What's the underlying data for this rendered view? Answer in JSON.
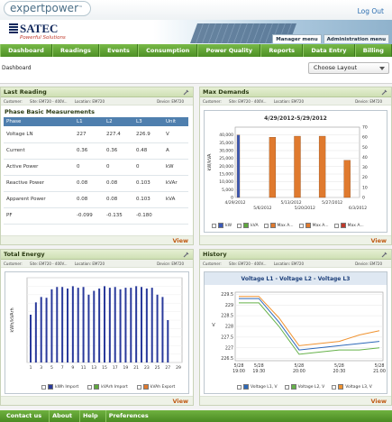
{
  "app": {
    "brand": "expertpower",
    "brand_tm": "™",
    "logout": "Log Out"
  },
  "company": {
    "name": "SATEC",
    "tagline": "Powerful Solutions"
  },
  "menus": {
    "manager": "Manager menu",
    "admin": "Administration menu"
  },
  "nav": [
    "Dashboard",
    "Readings",
    "Events",
    "Consumption",
    "Power Quality",
    "Reports",
    "Data Entry",
    "Billing"
  ],
  "page": {
    "title": "Dashboard",
    "layout_select": "Choose Layout"
  },
  "meta": {
    "customer": "Customer:",
    "site": "Site: EM720 - 400V...",
    "location": "Location: EM720",
    "device": "Device: EM720"
  },
  "view_label": "View",
  "last_reading": {
    "title": "Last Reading",
    "subtitle": "Phase Basic Measurements",
    "columns": [
      "Phase",
      "L1",
      "L2",
      "L3",
      "Unit"
    ],
    "rows": [
      [
        "Voltage LN",
        "227",
        "227.4",
        "226.9",
        "V"
      ],
      [
        "Current",
        "0.36",
        "0.36",
        "0.48",
        "A"
      ],
      [
        "Active Power",
        "0",
        "0",
        "0",
        "kW"
      ],
      [
        "Reactive Power",
        "0.08",
        "0.08",
        "0.103",
        "kVAr"
      ],
      [
        "Apparent Power",
        "0.08",
        "0.08",
        "0.103",
        "kVA"
      ],
      [
        "PF",
        "-0.099",
        "-0.135",
        "-0.180",
        ""
      ]
    ]
  },
  "max_demands": {
    "title": "Max Demands",
    "legend": [
      "kW",
      "kVA",
      "Max A...",
      "Max A...",
      "Max A..."
    ]
  },
  "total_energy": {
    "title": "Total Energy",
    "legend": [
      "kWh Import",
      "kVArh Import",
      "kVAh Export"
    ]
  },
  "history": {
    "title": "History",
    "legend": [
      "Voltage L1, V",
      "Voltage L2, V",
      "Voltage L3, V"
    ]
  },
  "footer": [
    "Contact us",
    "About",
    "Help",
    "Preferences"
  ],
  "colors": {
    "nav_green": "#5a9e30",
    "header_blue": "#4f7fae",
    "view_orange": "#c05a14"
  },
  "chart_data": [
    {
      "type": "bar",
      "title": "4/29/2012-5/29/2012",
      "ylabel": "kW/kVA",
      "ylim": [
        0,
        45000
      ],
      "yticks": [
        0,
        5000,
        10000,
        15000,
        20000,
        25000,
        30000,
        35000,
        40000
      ],
      "y2lim": [
        0,
        70
      ],
      "y2ticks": [
        0,
        10,
        20,
        30,
        40,
        50,
        60,
        70
      ],
      "categories": [
        "4/29/2012\n5/6/2012",
        "5/6/2012",
        "5/13/2012",
        "5/20/2012",
        "5/27/2012\n6/3/2012"
      ],
      "xticklabels": [
        "4/29/2012",
        "5/6/2012",
        "5/13/2012",
        "5/20/2012",
        "5/27/2012",
        "6/3/2012"
      ],
      "series": [
        {
          "name": "kW",
          "axis": "y",
          "color": "#3b5ab8",
          "values": [
            40000,
            0,
            0,
            0,
            0
          ]
        },
        {
          "name": "Max A...",
          "axis": "y2",
          "color": "#e07a2e",
          "values": [
            0,
            60,
            61,
            61,
            37
          ]
        }
      ]
    },
    {
      "type": "bar",
      "ylabel": "kWh/kVArh",
      "ylim": [
        0,
        1.1
      ],
      "categories": [
        "1",
        "2",
        "3",
        "4",
        "5",
        "6",
        "7",
        "8",
        "9",
        "10",
        "11",
        "12",
        "13",
        "14",
        "15",
        "16",
        "17",
        "18",
        "19",
        "20",
        "21",
        "22",
        "23",
        "24",
        "25",
        "26",
        "27"
      ],
      "xticklabels": [
        "1",
        "3",
        "5",
        "7",
        "9",
        "11",
        "13",
        "15",
        "17",
        "19",
        "21",
        "23",
        "25",
        "27",
        "29"
      ],
      "series": [
        {
          "name": "kWh Import",
          "color": "#2a3a9b",
          "values": [
            0.62,
            0.78,
            0.85,
            0.84,
            0.95,
            0.98,
            0.98,
            0.96,
            0.99,
            0.97,
            0.98,
            0.88,
            0.93,
            0.96,
            0.99,
            0.97,
            0.98,
            0.95,
            0.97,
            0.97,
            0.99,
            0.98,
            0.96,
            0.97,
            0.88,
            0.85,
            0.55
          ]
        }
      ]
    },
    {
      "type": "line",
      "title": "Voltage L1 - Voltage L2 - Voltage L3",
      "ylabel": "V",
      "ylim": [
        226.4,
        229.6
      ],
      "yticks": [
        226.5,
        227,
        227.5,
        228,
        228.5,
        229,
        229.5
      ],
      "x": [
        "5/28 19:00",
        "5/28 19:30",
        "5/28 19:45",
        "5/28 20:00",
        "5/28 20:15",
        "5/28 20:30",
        "5/28 20:45",
        "5/28 21:00"
      ],
      "xticklabels": [
        "5/28\n19:00",
        "5/28\n19:30",
        "5/28\n20:00",
        "5/28\n20:30",
        "5/28\n21:00"
      ],
      "series": [
        {
          "name": "Voltage L1, V",
          "color": "#2d68b8",
          "values": [
            229.3,
            229.3,
            228.2,
            226.9,
            227.0,
            227.1,
            227.2,
            227.3
          ]
        },
        {
          "name": "Voltage L2, V",
          "color": "#66b24a",
          "values": [
            229.1,
            229.1,
            228.0,
            226.7,
            226.8,
            226.9,
            226.9,
            227.0
          ]
        },
        {
          "name": "Voltage L3, V",
          "color": "#f0922f",
          "values": [
            229.4,
            229.4,
            228.4,
            227.1,
            227.2,
            227.3,
            227.6,
            227.8
          ]
        }
      ]
    }
  ]
}
